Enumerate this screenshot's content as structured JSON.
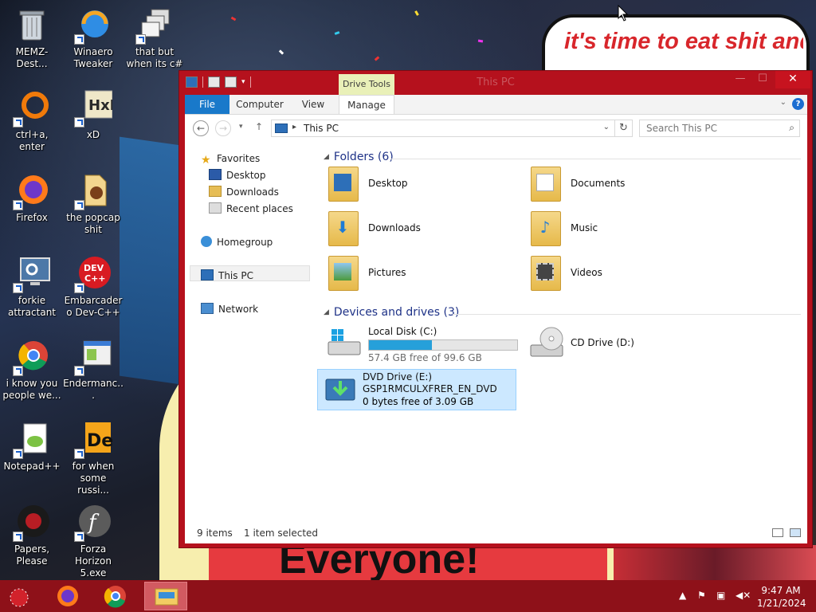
{
  "wallpaper": {
    "speech_text": "it's time to eat shit and die and celebrate",
    "banner_text": "Everyone!"
  },
  "desktop_icons": [
    {
      "label": "MEMZ-Dest...",
      "icon": "recycle-bin-icon"
    },
    {
      "label": "Winaero Tweaker",
      "icon": "winaero-icon"
    },
    {
      "label": "that but when its c#",
      "icon": "app-stack-icon"
    },
    {
      "label": "ctrl+a, enter",
      "icon": "ring-icon"
    },
    {
      "label": "xD",
      "icon": "hxd-icon"
    },
    {
      "label": "Firefox",
      "icon": "firefox-icon"
    },
    {
      "label": "the popcap shit",
      "icon": "popcap-icon"
    },
    {
      "label": "forkie attractant",
      "icon": "monitor-gear-icon"
    },
    {
      "label": "Embarcadero Dev-C++",
      "icon": "devcpp-icon"
    },
    {
      "label": "i know you people we...",
      "icon": "chrome-icon"
    },
    {
      "label": "Endermanc...",
      "icon": "window-icon"
    },
    {
      "label": "Notepad++",
      "icon": "notepadpp-icon"
    },
    {
      "label": "for when some russi...",
      "icon": "de-icon"
    },
    {
      "label": "Papers, Please",
      "icon": "papers-please-icon"
    },
    {
      "label": "Forza Horizon 5.exe",
      "icon": "flash-icon"
    }
  ],
  "window": {
    "title": "This PC",
    "contextual_tab": "Drive Tools",
    "tabs": [
      "File",
      "Computer",
      "View",
      "Manage"
    ],
    "address": {
      "crumb": "This PC"
    },
    "search_placeholder": "Search This PC",
    "nav": {
      "favorites": "Favorites",
      "desktop": "Desktop",
      "downloads": "Downloads",
      "recent": "Recent places",
      "homegroup": "Homegroup",
      "this_pc": "This PC",
      "network": "Network"
    },
    "folders_header": "Folders (6)",
    "folders": [
      {
        "name": "Desktop"
      },
      {
        "name": "Documents"
      },
      {
        "name": "Downloads"
      },
      {
        "name": "Music"
      },
      {
        "name": "Pictures"
      },
      {
        "name": "Videos"
      }
    ],
    "devices_header": "Devices and drives (3)",
    "drives": {
      "c": {
        "name": "Local Disk (C:)",
        "info": "57.4 GB free of 99.6 GB",
        "used_fraction": 0.424
      },
      "d": {
        "name": "CD Drive (D:)"
      },
      "e": {
        "name": "DVD Drive (E:)",
        "label": "GSP1RMCULXFRER_EN_DVD",
        "info": "0 bytes free of 3.09 GB"
      }
    },
    "status": {
      "items": "9 items",
      "selected": "1 item selected"
    }
  },
  "taskbar": {
    "time": "9:47 AM",
    "date": "1/21/2024"
  },
  "colors": {
    "window_frame": "#b5111d",
    "taskbar": "#8e1119",
    "accent_blue": "#1979ca",
    "progress": "#26a0da"
  }
}
